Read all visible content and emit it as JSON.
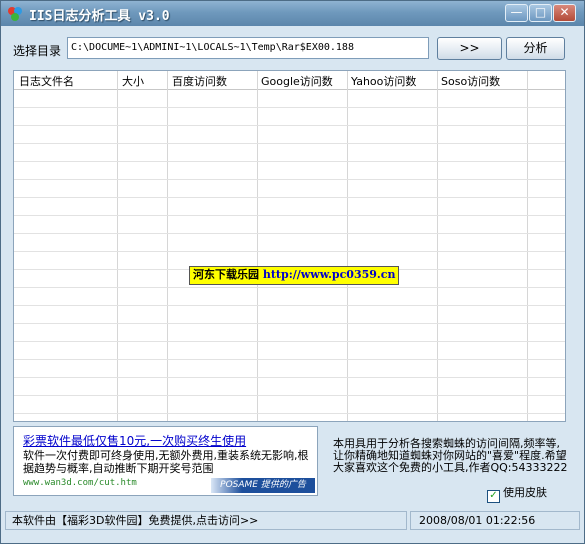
{
  "window": {
    "title": "IIS日志分析工具 v3.0",
    "minimize_glyph": "—",
    "maximize_glyph": "□",
    "close_glyph": "✕"
  },
  "toolbar": {
    "dir_label": "选择目录",
    "dir_value": "C:\\DOCUME~1\\ADMINI~1\\LOCALS~1\\Temp\\Rar$EX00.188",
    "browse_label": ">>",
    "analyze_label": "分析"
  },
  "table": {
    "columns": [
      "日志文件名",
      "大小",
      "百度访问数",
      "Google访问数",
      "Yahoo访问数",
      "Soso访问数"
    ],
    "rows": []
  },
  "watermark": {
    "site_name": "河东下载乐园",
    "url": "http://www.pc0359.cn"
  },
  "ad": {
    "title": "彩票软件最低仅售10元,一次购买终生使用",
    "body": "软件一次付费即可终身使用,无额外费用,重装系统无影响,根据趋势与概率,自动推断下期开奖号范围",
    "url": "www.wan3d.com/cut.htm",
    "badge": "POSAME 提供的广告"
  },
  "info": {
    "text": "本用具用于分析各搜索蜘蛛的访问间隔,频率等,让你精确地知道蜘蛛对你网站的\"喜爱\"程度.希望大家喜欢这个免费的小工具,作者QQ:54333222"
  },
  "skin": {
    "label": "使用皮肤",
    "checked": true,
    "check_glyph": "✓"
  },
  "status": {
    "left": "本软件由【福彩3D软件园】免费提供,点击访问>>",
    "datetime": "2008/08/01 01:22:56"
  },
  "colors": {
    "title_bar": "#6f99bd",
    "window_bg": "#d8e6f1",
    "link_blue": "#0000cc",
    "watermark_bg": "#ffff00"
  }
}
